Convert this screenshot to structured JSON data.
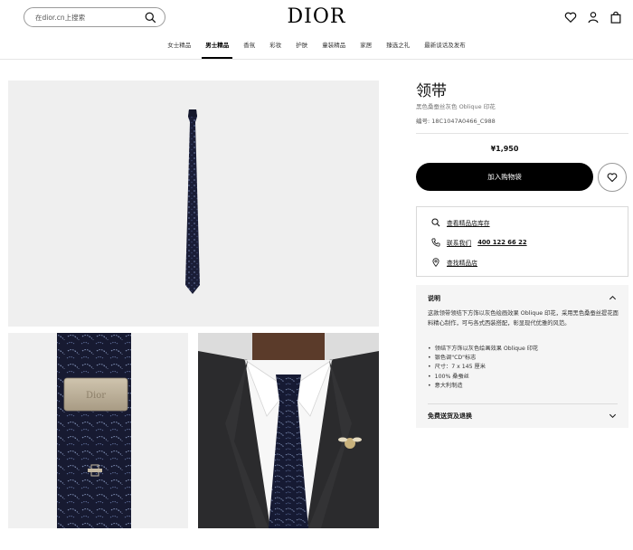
{
  "header": {
    "search_placeholder": "在dior.cn上搜索",
    "logo": "DIOR",
    "nav": [
      "女士精品",
      "男士精品",
      "香氛",
      "彩妆",
      "护肤",
      "童装精品",
      "家居",
      "臻选之礼",
      "最新谈话及发布"
    ],
    "active_nav": "男士精品"
  },
  "product": {
    "title": "领带",
    "subtitle": "黑色桑蚕丝灰色 Oblique 印花",
    "sku": "编号: 18C1047A0466_C988",
    "price": "¥1,950",
    "add_to_bag": "加入购物袋"
  },
  "store": {
    "check_stock": "查看精品店库存",
    "contact_prefix": "联系我们",
    "phone": "400 122 66 22",
    "find_store": "查找精品店"
  },
  "description": {
    "title": "说明",
    "text": "这款领带领结下方饰以灰色绘画效果 Oblique 印花，采用黑色桑蚕丝提花面料精心制作，可与各式西装搭配，彰显现代优雅的风范。",
    "features": [
      "领结下方饰以灰色绘画效果 Oblique 印花",
      "银色调\"CD\"标志",
      "尺寸：7 x 145 厘米",
      "100% 桑蚕丝",
      "意大利制造"
    ],
    "shipping_title": "免费送货及退换"
  },
  "colors": {
    "tie": "#1a1d36",
    "pattern": "#7f8fb5",
    "button": "#000000"
  },
  "images": {
    "detail_label": "Dior"
  }
}
